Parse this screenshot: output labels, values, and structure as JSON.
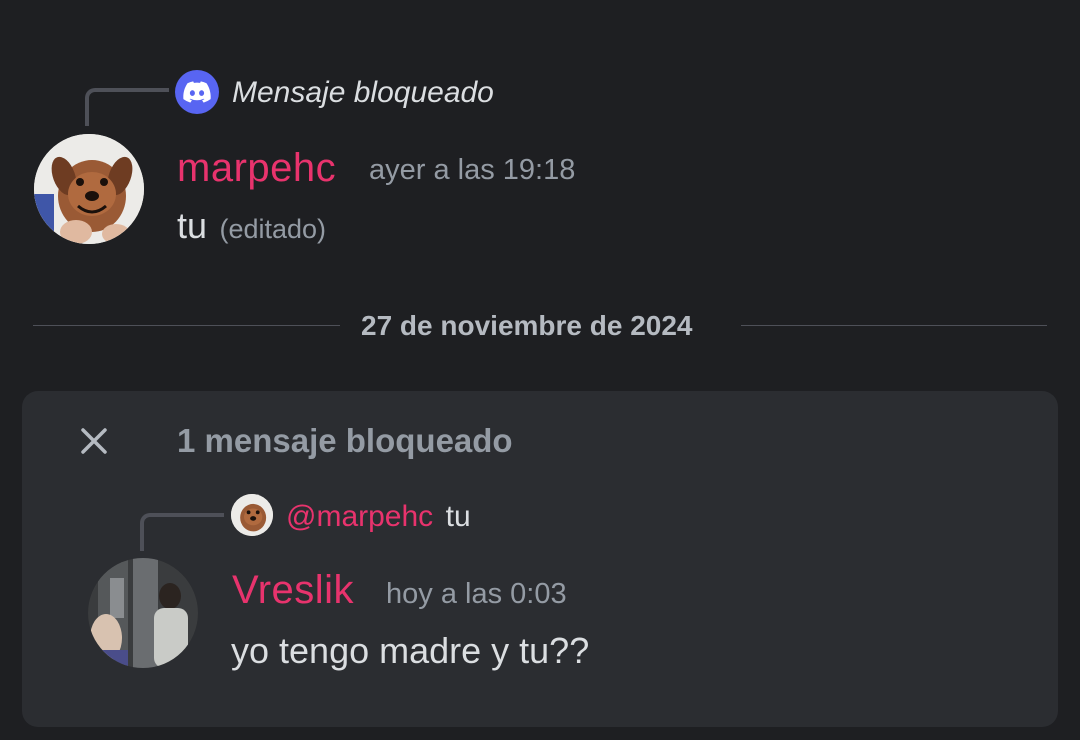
{
  "top_reply": {
    "text": "Mensaje bloqueado",
    "icon": "discord-logo-icon",
    "badge_color": "#5865f2"
  },
  "message1": {
    "username": "marpehc",
    "timestamp": "ayer a las 19:18",
    "content": "tu",
    "edited_label": "(editado)",
    "avatar": "dog-avatar"
  },
  "date_divider": {
    "text": "27 de noviembre de 2024"
  },
  "blocked_group": {
    "label": "1 mensaje bloqueado",
    "close_icon": "close-icon",
    "reply": {
      "mention": "@marpehc",
      "preview": "tu"
    },
    "message": {
      "username": "Vreslik",
      "timestamp": "hoy a las 0:03",
      "content": "yo tengo madre y tu??",
      "avatar": "elevator-photo-avatar"
    }
  },
  "colors": {
    "background": "#1e1f22",
    "panel": "#2b2d31",
    "username": "#e8336d",
    "muted": "#949ba4",
    "text": "#dbdee1",
    "blurple": "#5865f2"
  }
}
